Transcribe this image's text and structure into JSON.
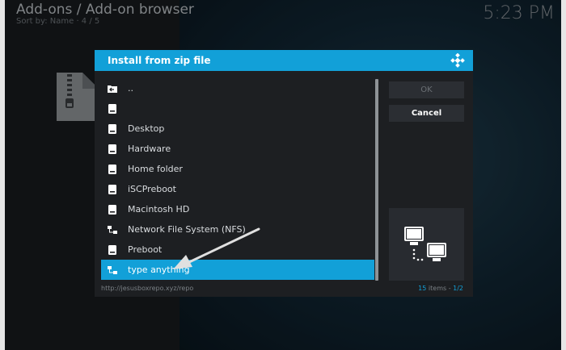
{
  "header": {
    "title": "Add-ons / Add-on browser",
    "sort_label": "Sort by: Name  ·  4 / 5"
  },
  "clock": "5:23 PM",
  "dialog": {
    "title": "Install from zip file",
    "ok_label": "OK",
    "cancel_label": "Cancel",
    "items": [
      {
        "label": "..",
        "icon": "parent-folder-icon"
      },
      {
        "label": "",
        "icon": "drive-icon"
      },
      {
        "label": "Desktop",
        "icon": "drive-icon"
      },
      {
        "label": "Hardware",
        "icon": "drive-icon"
      },
      {
        "label": "Home folder",
        "icon": "drive-icon"
      },
      {
        "label": "iSCPreboot",
        "icon": "drive-icon"
      },
      {
        "label": "Macintosh HD",
        "icon": "drive-icon"
      },
      {
        "label": "Network File System (NFS)",
        "icon": "network-icon"
      },
      {
        "label": "Preboot",
        "icon": "drive-icon"
      },
      {
        "label": "type anything",
        "icon": "network-icon",
        "selected": true
      }
    ],
    "path": "http://jesusboxrepo.xyz/repo",
    "item_count": "15",
    "item_count_suffix": "items - ",
    "page": "1/2"
  },
  "colors": {
    "accent": "#12a0d8",
    "dialog_bg": "#1d1f22",
    "button_bg": "#2b2e33"
  }
}
